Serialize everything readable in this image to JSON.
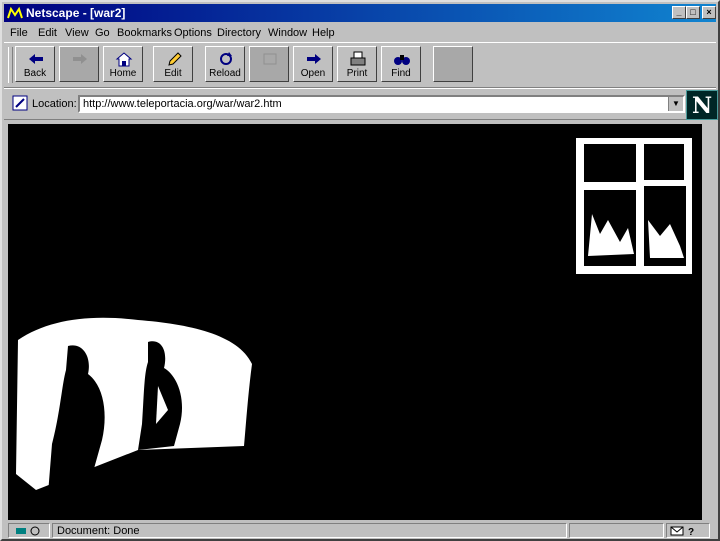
{
  "window": {
    "title": "Netscape - [war2]"
  },
  "menu": [
    "File",
    "Edit",
    "View",
    "Go",
    "Bookmarks",
    "Options",
    "Directory",
    "Window",
    "Help"
  ],
  "toolbar": {
    "back": "Back",
    "forward": "",
    "home": "Home",
    "edit": "Edit",
    "reload": "Reload",
    "images": "",
    "open": "Open",
    "print": "Print",
    "find": "Find",
    "stop": ""
  },
  "location": {
    "label": "Location:",
    "url": "http://www.teleportacia.org/war/war2.htm"
  },
  "logo": {
    "letter": "N"
  },
  "status": {
    "text": "Document: Done"
  },
  "colors": {
    "titlebar": "#000080",
    "content_bg": "#000000",
    "chrome": "#c0c0c0"
  }
}
